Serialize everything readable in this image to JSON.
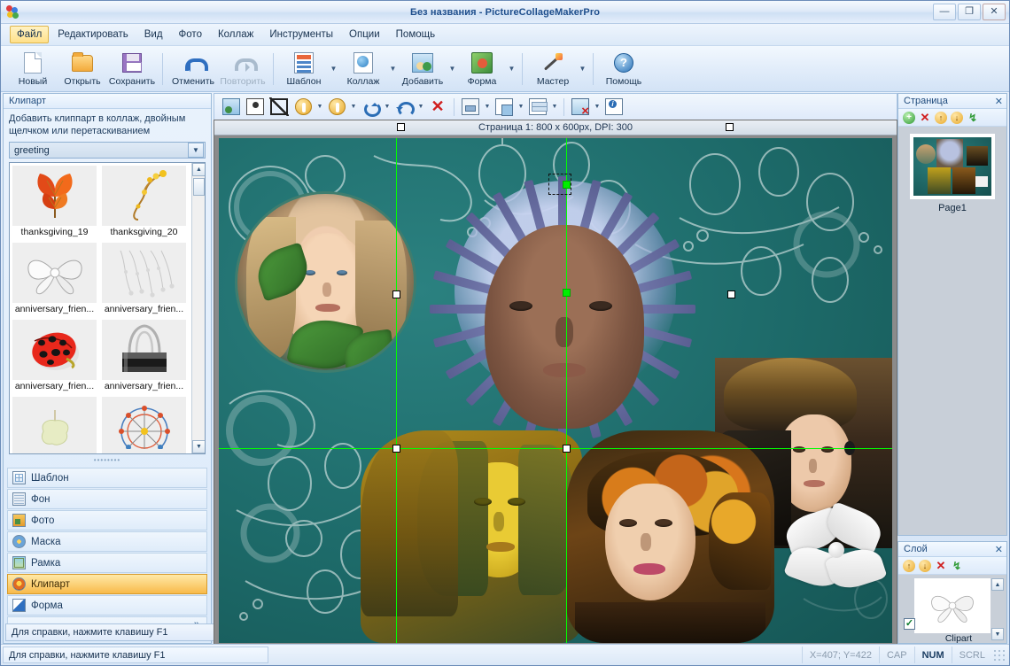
{
  "window": {
    "title": "Без названия - PictureCollageMakerPro",
    "minimize_label": "—",
    "maximize_label": "❐",
    "close_label": "✕"
  },
  "menubar": {
    "items": [
      {
        "label": "Файл",
        "active": true
      },
      {
        "label": "Редактировать",
        "active": false
      },
      {
        "label": "Вид",
        "active": false
      },
      {
        "label": "Фото",
        "active": false
      },
      {
        "label": "Коллаж",
        "active": false
      },
      {
        "label": "Инструменты",
        "active": false
      },
      {
        "label": "Опции",
        "active": false
      },
      {
        "label": "Помощь",
        "active": false
      }
    ]
  },
  "toolbar": {
    "buttons": [
      {
        "label": "Новый",
        "icon": "new-document-icon",
        "disabled": false,
        "dropdown": false
      },
      {
        "label": "Открыть",
        "icon": "open-folder-icon",
        "disabled": false,
        "dropdown": false
      },
      {
        "label": "Сохранить",
        "icon": "save-disk-icon",
        "disabled": false,
        "dropdown": false
      },
      {
        "label": "Отменить",
        "icon": "undo-arrow-icon",
        "disabled": false,
        "dropdown": false
      },
      {
        "label": "Повторить",
        "icon": "redo-arrow-icon",
        "disabled": true,
        "dropdown": false
      },
      {
        "label": "Шаблон",
        "icon": "template-icon",
        "disabled": false,
        "dropdown": true
      },
      {
        "label": "Коллаж",
        "icon": "collage-icon",
        "disabled": false,
        "dropdown": true
      },
      {
        "label": "Добавить",
        "icon": "add-photo-icon",
        "disabled": false,
        "dropdown": true
      },
      {
        "label": "Форма",
        "icon": "shape-icon",
        "disabled": false,
        "dropdown": true
      },
      {
        "label": "Мастер",
        "icon": "magic-wand-icon",
        "disabled": false,
        "dropdown": true
      },
      {
        "label": "Помощь",
        "icon": "help-circle-icon",
        "disabled": false,
        "dropdown": false
      }
    ]
  },
  "canvas_toolbar": {
    "buttons": [
      {
        "icon": "replace-photo-icon",
        "dropdown": false
      },
      {
        "icon": "edit-portrait-icon",
        "dropdown": false
      },
      {
        "icon": "crop-icon",
        "dropdown": false
      },
      {
        "icon": "zoom-in-coin-icon",
        "dropdown": true
      },
      {
        "icon": "zoom-out-coin-icon",
        "dropdown": true
      },
      {
        "icon": "rotate-cw-icon",
        "dropdown": true
      },
      {
        "icon": "rotate-ccw-icon",
        "dropdown": true
      },
      {
        "icon": "delete-x-icon",
        "dropdown": false
      },
      {
        "icon": "align-icon",
        "dropdown": true
      },
      {
        "icon": "arrange-order-icon",
        "dropdown": true
      },
      {
        "icon": "distribute-icon",
        "dropdown": true
      },
      {
        "icon": "clear-selection-icon",
        "dropdown": true
      },
      {
        "icon": "properties-info-icon",
        "dropdown": false
      }
    ]
  },
  "clipart_panel": {
    "title": "Клипарт",
    "hint": "Добавить клиппарт в коллаж, двойным щелчком или перетаскиванием",
    "category_value": "greeting",
    "category_placeholder": "greeting",
    "items": [
      {
        "name": "thanksgiving_19",
        "art": "autumn-leaf"
      },
      {
        "name": "thanksgiving_20",
        "art": "berry-branch"
      },
      {
        "name": "anniversary_frien...",
        "art": "white-bow"
      },
      {
        "name": "anniversary_frien...",
        "art": "pearl-strings"
      },
      {
        "name": "anniversary_frien...",
        "art": "ladybug"
      },
      {
        "name": "anniversary_frien...",
        "art": "binder-clip"
      },
      {
        "name": "",
        "art": "pale-blob"
      },
      {
        "name": "",
        "art": "ferris-wheel"
      }
    ],
    "scroll_up": "▲",
    "scroll_down": "▼"
  },
  "nav_list": {
    "items": [
      {
        "label": "Шаблон",
        "icon": "template-grid-icon",
        "selected": false
      },
      {
        "label": "Фон",
        "icon": "background-icon",
        "selected": false
      },
      {
        "label": "Фото",
        "icon": "photo-icon",
        "selected": false
      },
      {
        "label": "Маска",
        "icon": "mask-icon",
        "selected": false
      },
      {
        "label": "Рамка",
        "icon": "frame-icon",
        "selected": false
      },
      {
        "label": "Клипарт",
        "icon": "clipart-icon",
        "selected": true
      },
      {
        "label": "Форма",
        "icon": "shape-pen-icon",
        "selected": false
      }
    ],
    "more_label": "»"
  },
  "left_status": {
    "text": "Для справки, нажмите клавишу F1"
  },
  "canvas": {
    "page_info": "Страница 1: 800 x 600px, DPI: 300"
  },
  "page_panel": {
    "title": "Страница",
    "close_label": "✕",
    "tools": [
      {
        "icon": "add-page-icon",
        "label": "+"
      },
      {
        "icon": "delete-page-icon",
        "label": "✕"
      },
      {
        "icon": "move-up-icon",
        "label": "↑"
      },
      {
        "icon": "move-down-icon",
        "label": "↓"
      },
      {
        "icon": "refresh-icon",
        "label": "↯"
      }
    ],
    "page_label": "Page1"
  },
  "layer_panel": {
    "title": "Слой",
    "close_label": "✕",
    "tools": [
      {
        "icon": "layer-up-icon",
        "label": "↑"
      },
      {
        "icon": "layer-down-icon",
        "label": "↓"
      },
      {
        "icon": "layer-delete-icon",
        "label": "✕"
      },
      {
        "icon": "layer-refresh-icon",
        "label": "↯"
      }
    ],
    "layers": [
      {
        "name": "Clipart",
        "visible": true,
        "checkmark": "✓",
        "art": "white-bow"
      }
    ],
    "scroll_up": "▲",
    "scroll_down": "▼"
  },
  "statusbar": {
    "hint": "Для справки, нажмите клавишу F1",
    "coords": "X=407; Y=422",
    "indicators": [
      {
        "label": "CAP",
        "on": false
      },
      {
        "label": "NUM",
        "on": true
      },
      {
        "label": "SCRL",
        "on": false
      }
    ]
  },
  "colors": {
    "accent": "#1e4e8c",
    "selection_green": "#00ff00",
    "highlight_orange": "#f8ba4a",
    "canvas_teal": "#1f6d6c",
    "panel_blue": "#dceafa"
  }
}
